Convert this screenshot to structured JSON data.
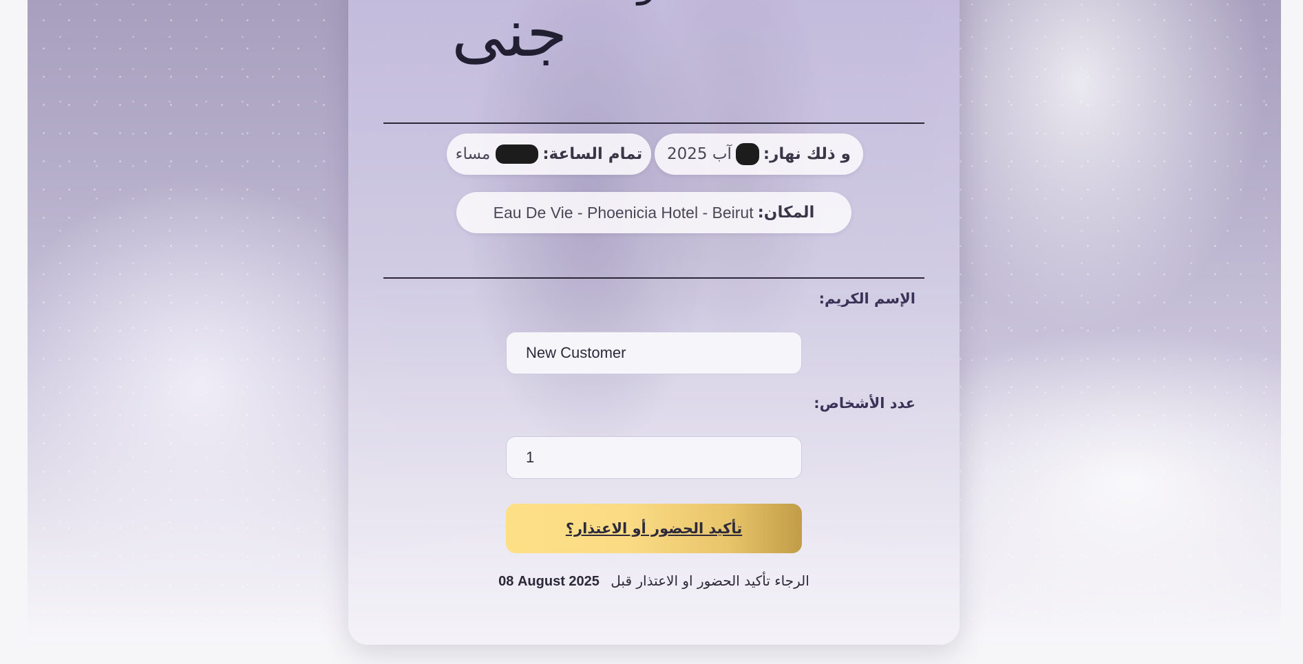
{
  "names": {
    "connector": "و",
    "bride": "جنى"
  },
  "event": {
    "date_label": "و ذلك نهار:",
    "date_value": "آب 2025",
    "time_label": "تمام الساعة:",
    "time_value": "مساء",
    "venue_label": "المكان:",
    "venue_value": "Eau De Vie - Phoenicia Hotel - Beirut"
  },
  "form": {
    "name_label": "الإسم الكريم:",
    "name_value": "New Customer",
    "guests_label": "عدد الأشخاص:",
    "guests_value": "1",
    "submit_label": "تأكيد الحضور أو الاعتذار؟"
  },
  "deadline": {
    "text": "الرجاء تأكيد الحضور او الاعتذار قبل",
    "date": "08 August 2025"
  },
  "colors": {
    "button_gradient_start": "#fde086",
    "button_gradient_end": "#c19d47",
    "text_dark": "#2b2838",
    "accent_purple": "#3a3358"
  }
}
